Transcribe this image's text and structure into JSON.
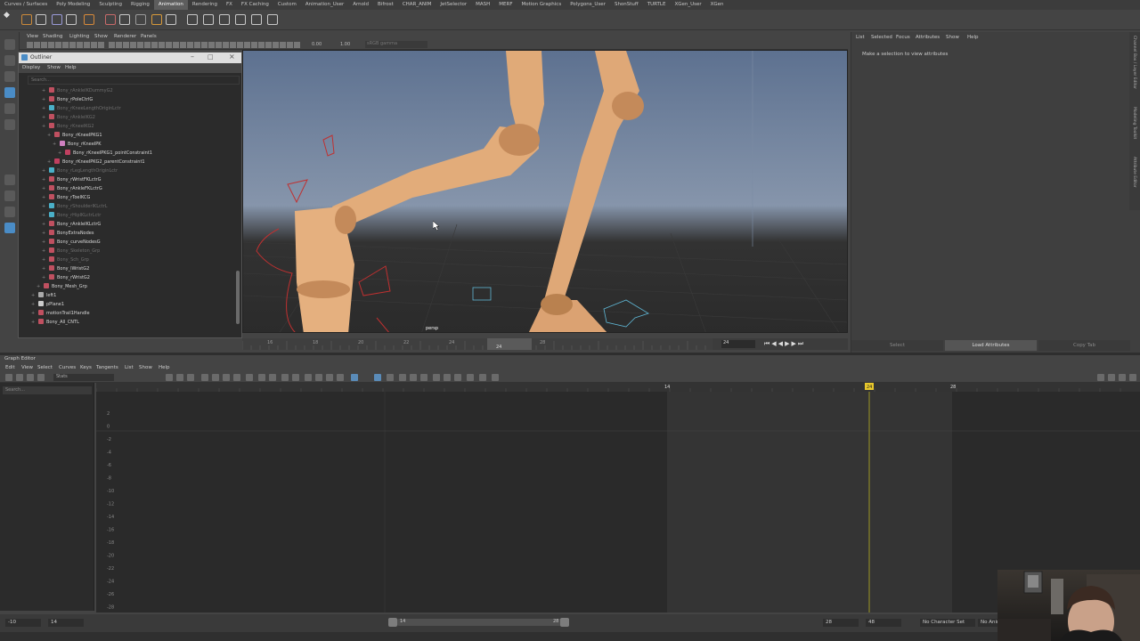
{
  "shelf_tabs": [
    "Curves / Surfaces",
    "Poly Modeling",
    "Sculpting",
    "Rigging",
    "Animation",
    "Rendering",
    "FX",
    "FX Caching",
    "Custom",
    "Animation_User",
    "Arnold",
    "Bifrost",
    "CHAR_ANIM",
    "JetSelector",
    "MASH",
    "MERF",
    "Motion Graphics",
    "Polygons_User",
    "ShonStuff",
    "TURTLE",
    "XGen_User",
    "XGen"
  ],
  "shelf_active": "Animation",
  "viewport_menu": [
    "View",
    "Shading",
    "Lighting",
    "Show",
    "Renderer",
    "Panels"
  ],
  "viewport_fields": {
    "exposure": "0.00",
    "gamma": "1.00",
    "colorspace": "sRGB gamma"
  },
  "viewport_label": "persp",
  "outliner": {
    "title": "Outliner",
    "menu": [
      "Display",
      "Show",
      "Help"
    ],
    "search_placeholder": "Search...",
    "rows": [
      {
        "label": "Bony_rAnkleIKDummyG2",
        "dim": true,
        "indent": 2,
        "icon": "transform"
      },
      {
        "label": "Bony_rPoleCtrlG",
        "dim": false,
        "indent": 2,
        "icon": "transform"
      },
      {
        "label": "Bony_rKneeLengthOriginLctr",
        "dim": true,
        "indent": 2,
        "icon": "locator"
      },
      {
        "label": "Bony_rAnkleIKG2",
        "dim": true,
        "indent": 2,
        "icon": "transform"
      },
      {
        "label": "Bony_rKneeIKG2",
        "dim": true,
        "indent": 2,
        "icon": "transform"
      },
      {
        "label": "Bony_rKneeIPKG1",
        "dim": false,
        "indent": 3,
        "icon": "transform"
      },
      {
        "label": "Bony_rKneeIPK",
        "dim": false,
        "indent": 4,
        "icon": "joint"
      },
      {
        "label": "Bony_rKneeIPKG1_pointConstraint1",
        "dim": false,
        "indent": 5,
        "icon": "constraint"
      },
      {
        "label": "Bony_rKneeIPKG2_parentConstraint1",
        "dim": false,
        "indent": 3,
        "icon": "constraint"
      },
      {
        "label": "Bony_rLegLengthOriginLctr",
        "dim": true,
        "indent": 2,
        "icon": "locator"
      },
      {
        "label": "Bony_rWristFKLctrG",
        "dim": false,
        "indent": 2,
        "icon": "transform"
      },
      {
        "label": "Bony_rAnkleFKLctrG",
        "dim": false,
        "indent": 2,
        "icon": "transform"
      },
      {
        "label": "Bony_rToeIKCG",
        "dim": false,
        "indent": 2,
        "icon": "transform"
      },
      {
        "label": "Bony_rShoulderIKLctrL",
        "dim": true,
        "indent": 2,
        "icon": "locator"
      },
      {
        "label": "Bony_rHipIKLctrLctr",
        "dim": true,
        "indent": 2,
        "icon": "locator"
      },
      {
        "label": "Bony_rAnkleIKLctrG",
        "dim": false,
        "indent": 2,
        "icon": "transform"
      },
      {
        "label": "BonyExtraNodes",
        "dim": false,
        "indent": 2,
        "icon": "transform"
      },
      {
        "label": "Bony_curveNodesG",
        "dim": false,
        "indent": 2,
        "icon": "transform"
      },
      {
        "label": "Bony_Skeleton_Grp",
        "dim": true,
        "indent": 2,
        "icon": "transform"
      },
      {
        "label": "Bony_Sch_Grp",
        "dim": true,
        "indent": 2,
        "icon": "transform"
      },
      {
        "label": "Bony_lWristG2",
        "dim": false,
        "indent": 2,
        "icon": "transform"
      },
      {
        "label": "Bony_rWristG2",
        "dim": false,
        "indent": 2,
        "icon": "transform"
      },
      {
        "label": "Bony_Mesh_Grp",
        "dim": false,
        "indent": 1,
        "icon": "transform"
      },
      {
        "label": "left1",
        "dim": false,
        "indent": 0,
        "icon": "camera"
      },
      {
        "label": "pPlane1",
        "dim": false,
        "indent": 0,
        "icon": "mesh"
      },
      {
        "label": "motionTrail1Handle",
        "dim": false,
        "indent": 0,
        "icon": "transform"
      },
      {
        "label": "Bony_All_CNTL",
        "dim": false,
        "indent": 0,
        "icon": "transform"
      }
    ]
  },
  "timeslider": {
    "ticks": [
      "16",
      "18",
      "20",
      "22",
      "24",
      "26",
      "28"
    ],
    "current": "24",
    "playhead_field": "24"
  },
  "attribute_panel": {
    "menu": [
      "List",
      "Selected",
      "Focus",
      "Attributes",
      "Show",
      "Help"
    ],
    "message": "Make a selection to view attributes",
    "buttons": [
      "Select",
      "Load Attributes",
      "Copy Tab"
    ]
  },
  "side_tabs": [
    "Channel Box / Layer Editor",
    "Modeling Toolkit",
    "Attribute Editor"
  ],
  "graph_editor": {
    "title": "Graph Editor",
    "menu": [
      "Edit",
      "View",
      "Select",
      "Curves",
      "Keys",
      "Tangents",
      "List",
      "Show",
      "Help"
    ],
    "stats_label": "Stats",
    "search_placeholder": "Search...",
    "y_ticks": [
      "2",
      "0",
      "-2",
      "-4",
      "-6",
      "-8",
      "-10",
      "-12",
      "-14",
      "-16",
      "-18",
      "-20",
      "-22",
      "-24",
      "-26",
      "-28"
    ],
    "x_markers": {
      "start": "14",
      "current": "24",
      "end": "28"
    }
  },
  "range": {
    "start_field": "-10",
    "inner_start": "14",
    "range_start": "14",
    "range_end": "28",
    "inner_end": "28",
    "end_field": "48",
    "char_set": "No Character Set",
    "anim_layer": "No Anim"
  },
  "colors": {
    "accent": "#4a8cc6",
    "playhead": "#e8c82c",
    "skin": "#e0aa78"
  }
}
